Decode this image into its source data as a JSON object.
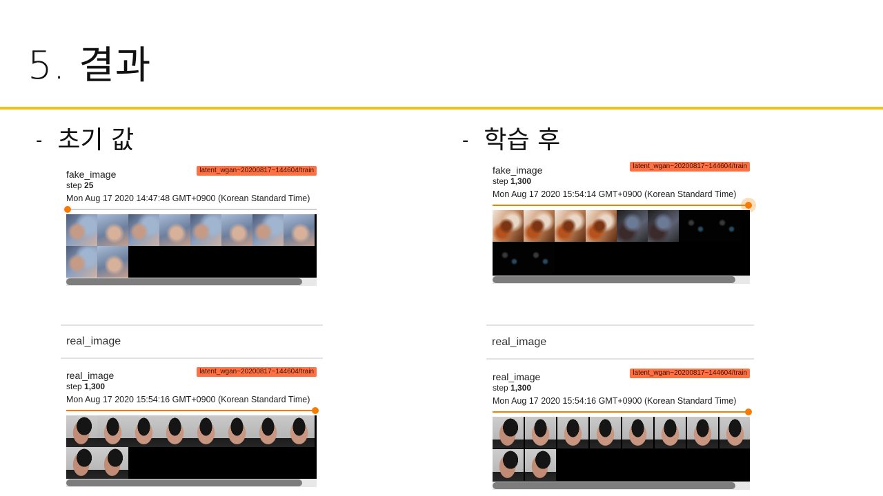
{
  "slide": {
    "title": "5. 결과",
    "accent_color": "#f2c01d"
  },
  "left": {
    "heading": "초기 값",
    "fake": {
      "name": "fake_image",
      "step_label": "step",
      "step": "25",
      "timestamp": "Mon Aug 17 2020 14:47:48 GMT+0900 (Korean Standard Time)",
      "run": "latent_wgan~20200817~144604/train"
    },
    "group_label": "real_image",
    "real": {
      "name": "real_image",
      "step_label": "step",
      "step": "1,300",
      "timestamp": "Mon Aug 17 2020 15:54:16 GMT+0900 (Korean Standard Time)",
      "run": "latent_wgan~20200817~144604/train"
    }
  },
  "right": {
    "heading": "학습 후",
    "fake": {
      "name": "fake_image",
      "step_label": "step",
      "step": "1,300",
      "timestamp": "Mon Aug 17 2020 15:54:14 GMT+0900 (Korean Standard Time)",
      "run": "latent_wgan~20200817~144604/train"
    },
    "group_label": "real_image",
    "real": {
      "name": "real_image",
      "step_label": "step",
      "step": "1,300",
      "timestamp": "Mon Aug 17 2020 15:54:16 GMT+0900 (Korean Standard Time)",
      "run": "latent_wgan~20200817~144604/train"
    }
  },
  "colors": {
    "run_chip": "#ff7043",
    "slider": "#f57c00",
    "scrollbar": "#7d7d7d"
  }
}
